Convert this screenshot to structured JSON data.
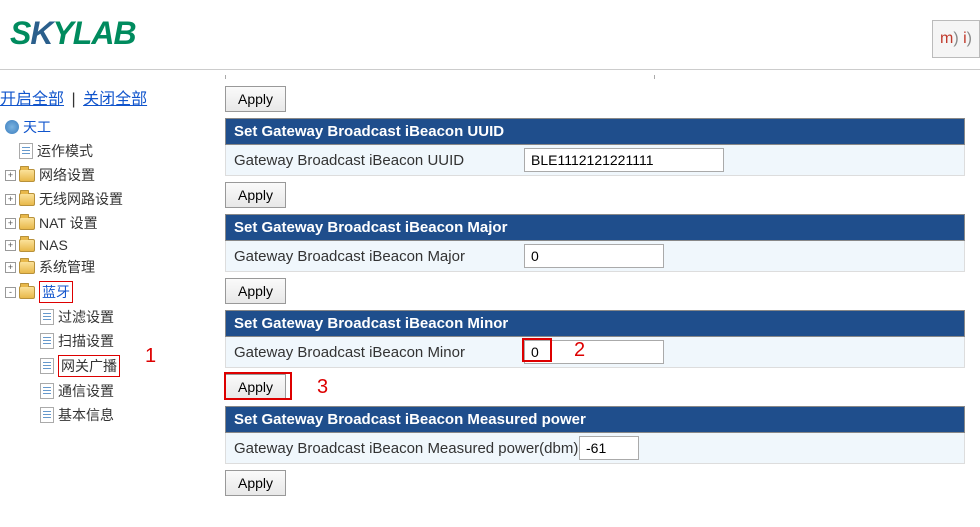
{
  "header": {
    "logo_text_s": "S",
    "logo_text_k": "K",
    "logo_text_rest": "YLAB",
    "right_badge": "m) i) "
  },
  "toplinks": {
    "open_all": "开启全部",
    "close_all": "关闭全部"
  },
  "sidebar": {
    "root": "天工",
    "items": [
      {
        "label": "运作模式",
        "type": "page"
      },
      {
        "label": "网络设置",
        "type": "folder",
        "expand": "+"
      },
      {
        "label": "无线网路设置",
        "type": "folder",
        "expand": "+"
      },
      {
        "label": "NAT 设置",
        "type": "folder",
        "expand": "+"
      },
      {
        "label": "NAS",
        "type": "folder",
        "expand": "+"
      },
      {
        "label": "系统管理",
        "type": "folder",
        "expand": "+"
      },
      {
        "label": "蓝牙",
        "type": "folder",
        "expand": "-",
        "highlighted": true
      }
    ],
    "bluetooth_children": [
      {
        "label": "过滤设置"
      },
      {
        "label": "扫描设置"
      },
      {
        "label": "网关广播",
        "highlighted": true
      },
      {
        "label": "通信设置"
      },
      {
        "label": "基本信息"
      }
    ]
  },
  "content": {
    "apply_label": "Apply",
    "sections": [
      {
        "title": "Set Gateway Broadcast iBeacon UUID",
        "field_label": "Gateway Broadcast iBeacon UUID",
        "field_value": "BLE1112121221111"
      },
      {
        "title": "Set Gateway Broadcast iBeacon Major",
        "field_label": "Gateway Broadcast iBeacon Major",
        "field_value": "0"
      },
      {
        "title": "Set Gateway Broadcast iBeacon Minor",
        "field_label": "Gateway Broadcast iBeacon Minor",
        "field_value": "0"
      },
      {
        "title": "Set Gateway Broadcast iBeacon Measured power",
        "field_label": "Gateway Broadcast iBeacon Measured power(dbm)",
        "field_value": "-61"
      }
    ]
  },
  "annotations": {
    "n1": "1",
    "n2": "2",
    "n3": "3"
  }
}
